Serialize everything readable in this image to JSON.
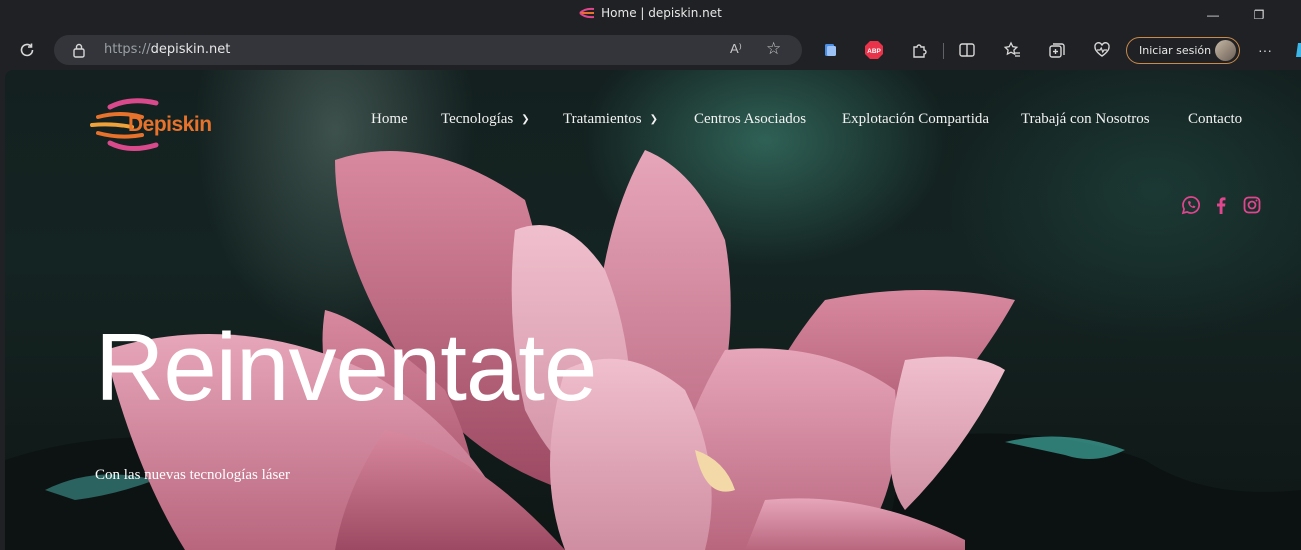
{
  "window": {
    "title": "Home | depiskin.net",
    "minimize_glyph": "—",
    "restore_glyph": "❐",
    "favicon_icon": "depiskin-favicon"
  },
  "toolbar": {
    "url_protocol": "https://",
    "url_host": "depiskin.net",
    "read_aloud_glyph": "A⁾",
    "signin_label": "Iniciar sesión",
    "more_glyph": "···"
  },
  "site": {
    "logo_text": "Depiskin",
    "nav": [
      {
        "label": "Home"
      },
      {
        "label": "Tecnologías"
      },
      {
        "label": "Tratamientos"
      },
      {
        "label": "Centros Asociados"
      },
      {
        "label": "Explotación Compartida"
      },
      {
        "label": "Trabajá con Nosotros"
      },
      {
        "label": "Contacto"
      }
    ],
    "dropdown_glyph": "⌄",
    "social": [
      "whatsapp-icon",
      "facebook-icon",
      "instagram-icon"
    ],
    "accent_color": "#e0458e",
    "logo_color": "#e6722c"
  },
  "hero": {
    "title": "Reinventate",
    "subtitle": "Con las nuevas tecnologías láser"
  }
}
